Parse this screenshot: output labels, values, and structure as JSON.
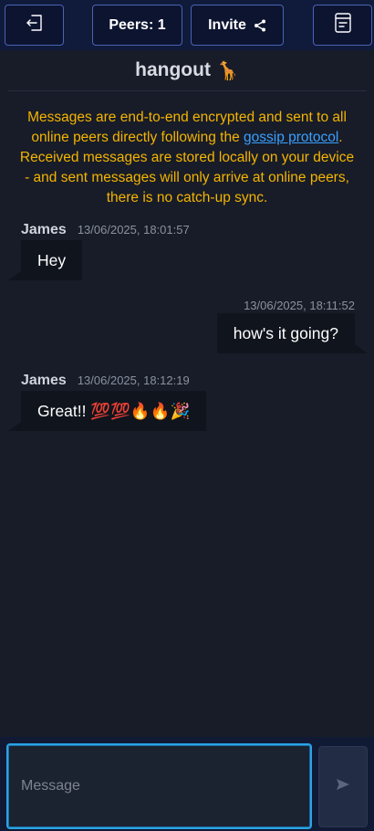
{
  "header": {
    "leave_icon": "exit-icon",
    "peers_label": "Peers: 1",
    "invite_label": "Invite",
    "invite_icon": "share-icon",
    "notes_icon": "notes-icon"
  },
  "room": {
    "title": "hangout",
    "emoji": "🦒"
  },
  "notice": {
    "before_link": "Messages are end-to-end encrypted and sent to all online peers directly following the ",
    "link_text": "gossip protocol",
    "after_link": ". Received messages are stored locally on your device - and sent messages will only arrive at online peers, there is no catch-up sync."
  },
  "messages": [
    {
      "author": "James",
      "time": "13/06/2025, 18:01:57",
      "text": "Hey",
      "direction": "incoming"
    },
    {
      "author": "",
      "time": "13/06/2025, 18:11:52",
      "text": "how's it going?",
      "direction": "outgoing"
    },
    {
      "author": "James",
      "time": "13/06/2025, 18:12:19",
      "text": "Great!! 💯💯🔥🔥🎉",
      "direction": "incoming"
    }
  ],
  "composer": {
    "placeholder": "Message",
    "send_icon": "send-icon"
  },
  "colors": {
    "accent": "#2aa3e6",
    "notice": "#f5b400",
    "link": "#3aa0ff",
    "button_border": "#4a63b5"
  }
}
